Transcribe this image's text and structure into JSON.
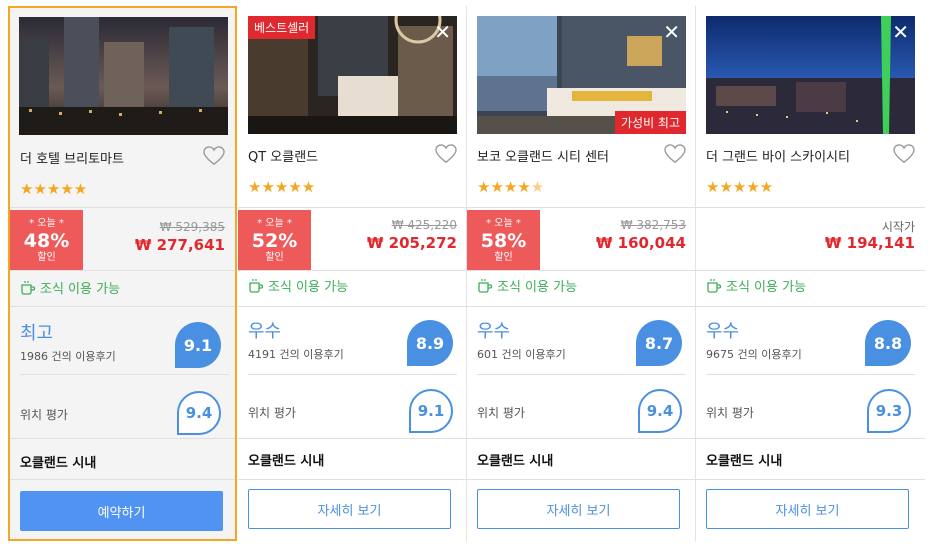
{
  "hotels": [
    {
      "name": "더 호텔 브리토마트",
      "stars": "★★★★★",
      "badge_top": "",
      "badge_bottom": "",
      "discount": {
        "today": "* 오늘 *",
        "percent": "48%",
        "label": "할인"
      },
      "price_old": "₩ 529,385",
      "price_new": "₩ 277,641",
      "price_prefix": "",
      "breakfast": "조식 이용 가능",
      "rating_word": "최고",
      "reviews": "1986 건의 이용후기",
      "score": "9.1",
      "location_label": "위치 평가",
      "location_score": "9.4",
      "district": "오클랜드 시내",
      "button": "예약하기",
      "selected": true
    },
    {
      "name": "QT 오클랜드",
      "stars": "★★★★★",
      "badge_top": "베스트셀러",
      "badge_bottom": "",
      "discount": {
        "today": "* 오늘 *",
        "percent": "52%",
        "label": "할인"
      },
      "price_old": "₩ 425,220",
      "price_new": "₩ 205,272",
      "price_prefix": "",
      "breakfast": "조식 이용 가능",
      "rating_word": "우수",
      "reviews": "4191 건의 이용후기",
      "score": "8.9",
      "location_label": "위치 평가",
      "location_score": "9.1",
      "district": "오클랜드 시내",
      "button": "자세히 보기",
      "selected": false
    },
    {
      "name": "보코 오클랜드 시티 센터",
      "stars": "★★★★",
      "badge_top": "",
      "badge_bottom": "가성비 최고",
      "discount": {
        "today": "* 오늘 *",
        "percent": "58%",
        "label": "할인"
      },
      "price_old": "₩ 382,753",
      "price_new": "₩ 160,044",
      "price_prefix": "",
      "breakfast": "조식 이용 가능",
      "rating_word": "우수",
      "reviews": "601 건의 이용후기",
      "score": "8.7",
      "location_label": "위치 평가",
      "location_score": "9.4",
      "district": "오클랜드 시내",
      "button": "자세히 보기",
      "selected": false
    },
    {
      "name": "더 그랜드 바이 스카이시티",
      "stars": "★★★★★",
      "badge_top": "",
      "badge_bottom": "",
      "discount": null,
      "price_old": "",
      "price_new": "₩ 194,141",
      "price_prefix": "시작가",
      "breakfast": "조식 이용 가능",
      "rating_word": "우수",
      "reviews": "9675 건의 이용후기",
      "score": "8.8",
      "location_label": "위치 평가",
      "location_score": "9.3",
      "district": "오클랜드 시내",
      "button": "자세히 보기",
      "selected": false
    }
  ],
  "icons": {
    "close": "close-icon",
    "heart": "heart-icon",
    "cup": "coffee-cup-icon"
  },
  "colors": {
    "accent": "#4a90e2",
    "sale": "#e0282f",
    "discount_bg": "#ee5a5a",
    "breakfast": "#3cae5a",
    "selected_border": "#f5a623"
  }
}
